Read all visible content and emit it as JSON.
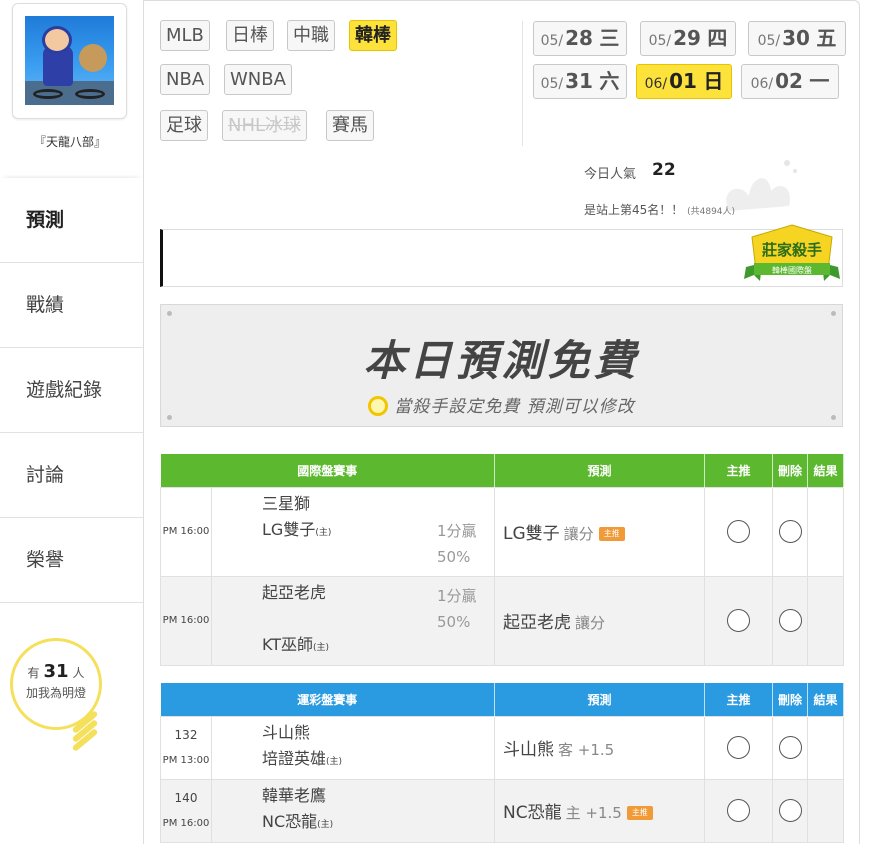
{
  "user": {
    "name": "『天龍八部』"
  },
  "nav": {
    "items": [
      {
        "label": "預測"
      },
      {
        "label": "戰績"
      },
      {
        "label": "遊戲紀錄"
      },
      {
        "label": "討論"
      },
      {
        "label": "榮譽"
      }
    ]
  },
  "fans": {
    "prefix": "有",
    "count": "31",
    "suffix": "人",
    "line2": "加我為明燈"
  },
  "sports": [
    {
      "label": "MLB"
    },
    {
      "label": "日棒"
    },
    {
      "label": "中職"
    },
    {
      "label": "韓棒",
      "state": "active"
    },
    {
      "label": "NBA"
    },
    {
      "label": "WNBA"
    },
    {
      "label": "足球"
    },
    {
      "label": "NHL冰球",
      "state": "disabled"
    },
    {
      "label": "賽馬"
    }
  ],
  "dates": [
    {
      "md": "05/",
      "day": "28",
      "wd": "三"
    },
    {
      "md": "05/",
      "day": "29",
      "wd": "四"
    },
    {
      "md": "05/",
      "day": "30",
      "wd": "五"
    },
    {
      "md": "05/",
      "day": "31",
      "wd": "六"
    },
    {
      "md": "06/",
      "day": "01",
      "wd": "日",
      "state": "active"
    },
    {
      "md": "06/",
      "day": "02",
      "wd": "一"
    }
  ],
  "popularity": {
    "label": "今日人氣",
    "value": "22",
    "rank_text": "是站上第45名！！",
    "rank_total": "(共4894人)"
  },
  "badge": {
    "title": "莊家殺手",
    "subtitle": "韓棒國際盤"
  },
  "free": {
    "title": "本日預測免費",
    "subtitle": "當殺手設定免費 預測可以修改"
  },
  "intl_table": {
    "headers": [
      "國際盤賽事",
      "預測",
      "主推",
      "刪除",
      "結果"
    ],
    "rows": [
      {
        "no": "",
        "time": "PM 16:00",
        "team1": "三星獅",
        "team1_tag": "",
        "team2": "LG雙子",
        "team2_tag": "(主)",
        "odds1": "1分贏",
        "odds2": "50%",
        "pick": "LG雙子",
        "pick_note": "讓分",
        "badge": "主推"
      },
      {
        "no": "",
        "time": "PM 16:00",
        "team1": "起亞老虎",
        "team1_tag": "",
        "team2": "KT巫師",
        "team2_tag": "(主)",
        "odds1": "1分贏",
        "odds2": "50%",
        "pick": "起亞老虎",
        "pick_note": "讓分",
        "badge": ""
      }
    ]
  },
  "sports_table": {
    "headers": [
      "運彩盤賽事",
      "預測",
      "主推",
      "刪除",
      "結果"
    ],
    "rows": [
      {
        "no": "132",
        "time": "PM 13:00",
        "team1": "斗山熊",
        "team1_tag": "",
        "team2": "培證英雄",
        "team2_tag": "(主)",
        "odds1": "",
        "odds2": "",
        "pick": "斗山熊",
        "pick_note": "客 +1.5",
        "badge": ""
      },
      {
        "no": "140",
        "time": "PM 16:00",
        "team1": "韓華老鷹",
        "team1_tag": "",
        "team2": "NC恐龍",
        "team2_tag": "(主)",
        "odds1": "",
        "odds2": "",
        "pick": "NC恐龍",
        "pick_note": "主 +1.5",
        "badge": "主推"
      }
    ]
  },
  "colors": {
    "accent_yellow": "#fde23b",
    "intl_header": "#5cb82f",
    "sports_header": "#2a9be0",
    "badge_orange": "#f19a38"
  }
}
